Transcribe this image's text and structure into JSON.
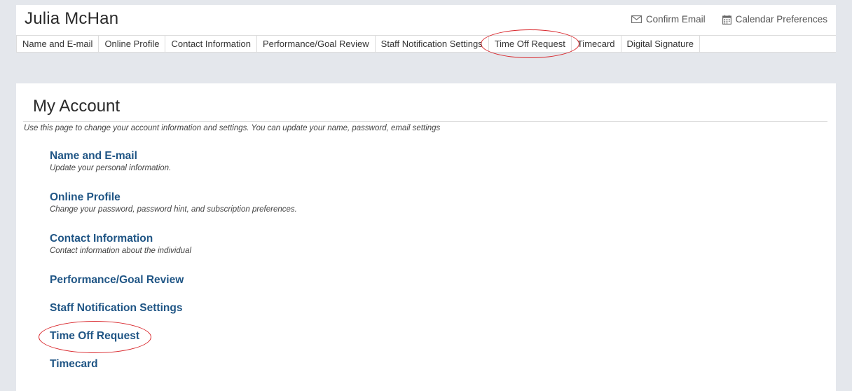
{
  "header": {
    "user_name": "Julia McHan",
    "actions": [
      {
        "label": "Confirm Email",
        "icon": "envelope-icon"
      },
      {
        "label": "Calendar Preferences",
        "icon": "calendar-icon"
      }
    ]
  },
  "tabs": [
    {
      "label": "Name and E-mail"
    },
    {
      "label": "Online Profile"
    },
    {
      "label": "Contact Information"
    },
    {
      "label": "Performance/Goal Review"
    },
    {
      "label": "Staff Notification Settings"
    },
    {
      "label": "Time Off Request"
    },
    {
      "label": "Timecard"
    },
    {
      "label": "Digital Signature"
    }
  ],
  "main": {
    "title": "My Account",
    "description": "Use this page to change your account information and settings. You can update your name, password, email settings",
    "items": [
      {
        "label": "Name and E-mail",
        "description": "Update your personal information."
      },
      {
        "label": "Online Profile",
        "description": "Change your password, password hint, and subscription preferences."
      },
      {
        "label": "Contact Information",
        "description": "Contact information about the individual"
      },
      {
        "label": "Performance/Goal Review",
        "description": ""
      },
      {
        "label": "Staff Notification Settings",
        "description": ""
      },
      {
        "label": "Time Off Request",
        "description": ""
      },
      {
        "label": "Timecard",
        "description": ""
      }
    ]
  },
  "colors": {
    "page_background": "#e4e7ec",
    "link": "#1f5585",
    "annotation": "#d9262b"
  }
}
